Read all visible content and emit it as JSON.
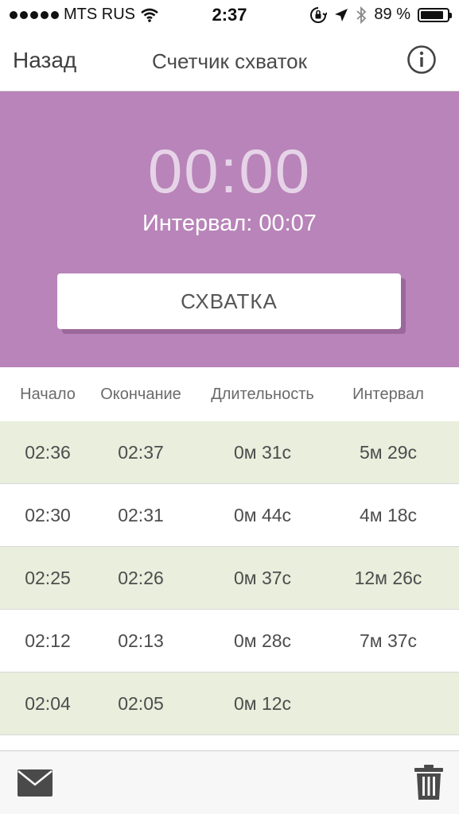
{
  "status_bar": {
    "carrier": "MTS RUS",
    "time": "2:37",
    "battery": "89 %",
    "battery_level": 0.89
  },
  "nav": {
    "back_label": "Назад",
    "title": "Счетчик схваток"
  },
  "timer": {
    "clock": "00:00",
    "interval_text": "Интервал: 00:07",
    "button_label": "СХВАТКА"
  },
  "table": {
    "headers": [
      "Начало",
      "Окончание",
      "Длительность",
      "Интервал"
    ],
    "rows": [
      {
        "start": "02:36",
        "end": "02:37",
        "duration": "0м 31с",
        "interval": "5м 29с"
      },
      {
        "start": "02:30",
        "end": "02:31",
        "duration": "0м 44с",
        "interval": "4м 18с"
      },
      {
        "start": "02:25",
        "end": "02:26",
        "duration": "0м 37с",
        "interval": "12м 26с"
      },
      {
        "start": "02:12",
        "end": "02:13",
        "duration": "0м 28с",
        "interval": "7м 37с"
      },
      {
        "start": "02:04",
        "end": "02:05",
        "duration": "0м 12с",
        "interval": ""
      }
    ]
  },
  "colors": {
    "accent": "#b884b9",
    "row_shade": "#e9eedd"
  },
  "toolbar": {
    "icons": [
      "mail-icon",
      "trash-icon"
    ]
  }
}
